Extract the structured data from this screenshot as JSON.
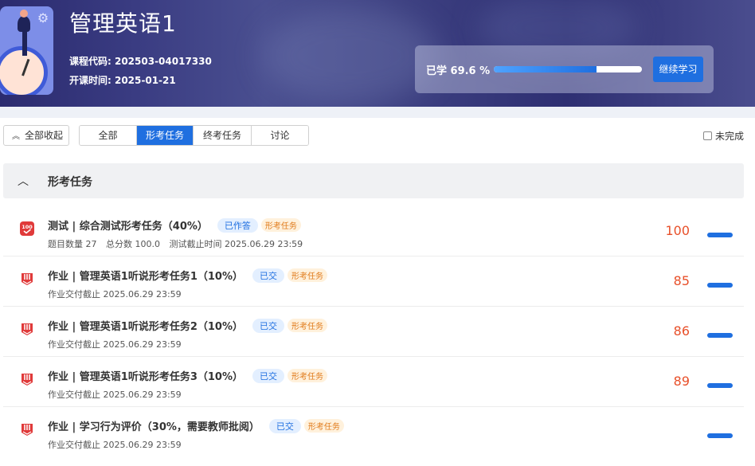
{
  "course": {
    "title": "管理英语1",
    "code_text": "课程代码: 202503-04017330",
    "date_text": "开课时间: 2025-01-21"
  },
  "progress": {
    "label": "已学 69.6 %",
    "percent": 69.6,
    "continue_label": "继续学习"
  },
  "toolbar": {
    "collapse_label": "全部收起",
    "tabs": [
      {
        "label": "全部",
        "active": false
      },
      {
        "label": "形考任务",
        "active": true
      },
      {
        "label": "终考任务",
        "active": false
      },
      {
        "label": "讨论",
        "active": false
      }
    ],
    "unfinished_label": "未完成"
  },
  "section": {
    "title": "形考任务"
  },
  "tasks": [
    {
      "icon": "test-100-icon",
      "name": "测试 | 综合测试形考任务（40%）",
      "status": "已作答",
      "type": "形考任务",
      "sub": [
        "题目数量 27",
        "总分数 100.0",
        "测试截止时间 2025.06.29 23:59"
      ],
      "score": "100"
    },
    {
      "icon": "homework-icon",
      "name": "作业 | 管理英语1听说形考任务1（10%）",
      "status": "已交",
      "type": "形考任务",
      "sub": [
        "作业交付截止 2025.06.29 23:59"
      ],
      "score": "85"
    },
    {
      "icon": "homework-icon",
      "name": "作业 | 管理英语1听说形考任务2（10%）",
      "status": "已交",
      "type": "形考任务",
      "sub": [
        "作业交付截止 2025.06.29 23:59"
      ],
      "score": "86"
    },
    {
      "icon": "homework-icon",
      "name": "作业 | 管理英语1听说形考任务3（10%）",
      "status": "已交",
      "type": "形考任务",
      "sub": [
        "作业交付截止 2025.06.29 23:59"
      ],
      "score": "89"
    },
    {
      "icon": "homework-icon",
      "name": "作业 | 学习行为评价（30%，需要教师批阅）",
      "status": "已交",
      "type": "形考任务",
      "sub": [
        "作业交付截止 2025.06.29 23:59"
      ],
      "score": ""
    }
  ],
  "colors": {
    "accent": "#1f6fe0",
    "score": "#e8502a",
    "icon_red": "#e03a3a"
  }
}
